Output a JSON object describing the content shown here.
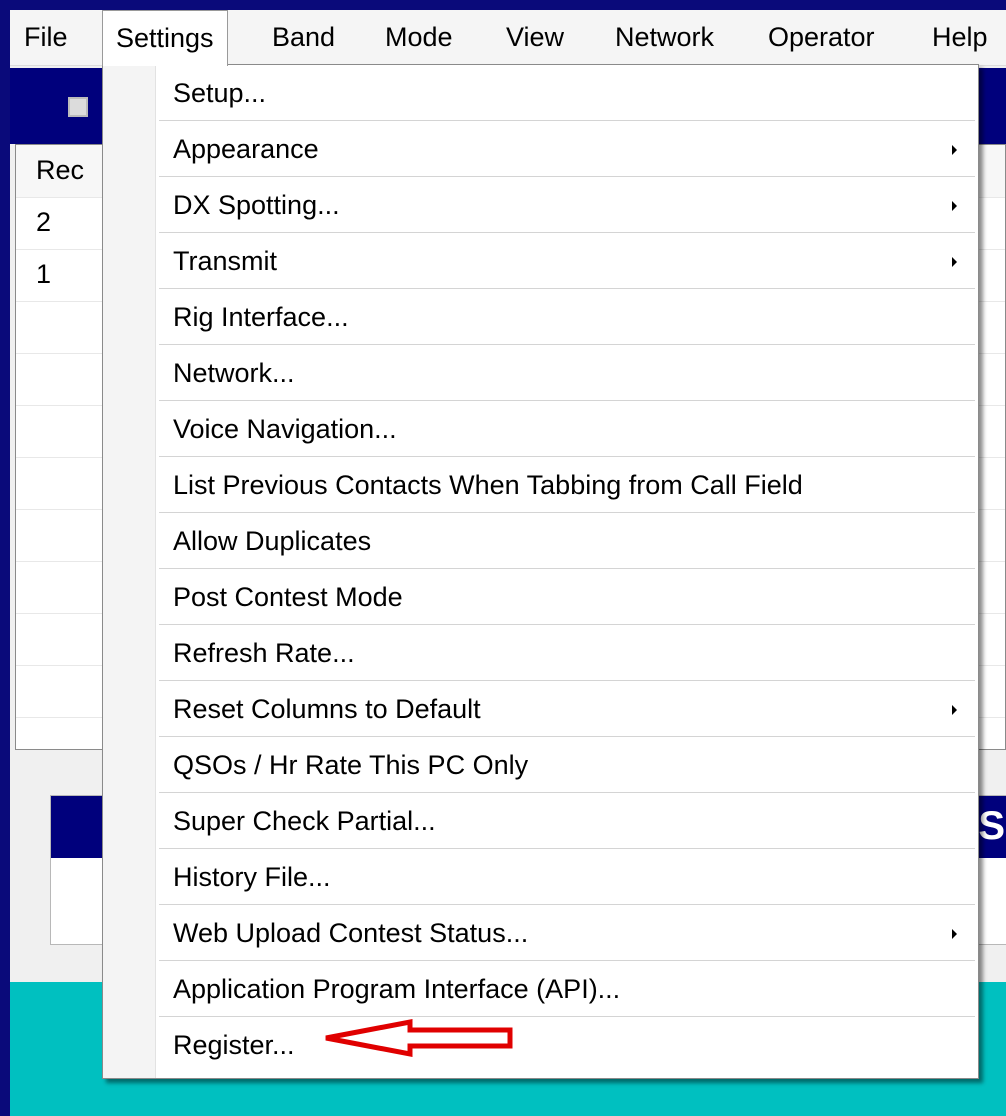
{
  "menubar": {
    "items": [
      "File",
      "Settings",
      "Band",
      "Mode",
      "View",
      "Network",
      "Operator",
      "Help"
    ],
    "active": "Settings"
  },
  "background": {
    "column_header": "Rec",
    "rows": [
      "2",
      "1"
    ],
    "status_fragment": "S"
  },
  "settings_menu": {
    "items": [
      {
        "label": "Setup...",
        "submenu": false
      },
      {
        "label": "Appearance",
        "submenu": true
      },
      {
        "label": "DX Spotting...",
        "submenu": true
      },
      {
        "label": "Transmit",
        "submenu": true
      },
      {
        "label": "Rig Interface...",
        "submenu": false
      },
      {
        "label": "Network...",
        "submenu": false
      },
      {
        "label": "Voice Navigation...",
        "submenu": false
      },
      {
        "label": "List Previous Contacts When Tabbing from Call Field",
        "submenu": false
      },
      {
        "label": "Allow Duplicates",
        "submenu": false
      },
      {
        "label": "Post Contest Mode",
        "submenu": false
      },
      {
        "label": "Refresh Rate...",
        "submenu": false
      },
      {
        "label": "Reset Columns to Default",
        "submenu": true
      },
      {
        "label": "QSOs / Hr Rate This PC Only",
        "submenu": false
      },
      {
        "label": "Super Check Partial...",
        "submenu": false
      },
      {
        "label": "History File...",
        "submenu": false
      },
      {
        "label": "Web Upload Contest Status...",
        "submenu": true
      },
      {
        "label": "Application Program Interface (API)...",
        "submenu": false
      },
      {
        "label": "Register...",
        "submenu": false
      }
    ]
  },
  "colors": {
    "frame": "#0a0a7a",
    "header_blue": "#00007c",
    "teal": "#00c0c0",
    "annotation_arrow": "#e00000"
  },
  "annotation": {
    "type": "arrow-icon",
    "points_to": "Register..."
  }
}
